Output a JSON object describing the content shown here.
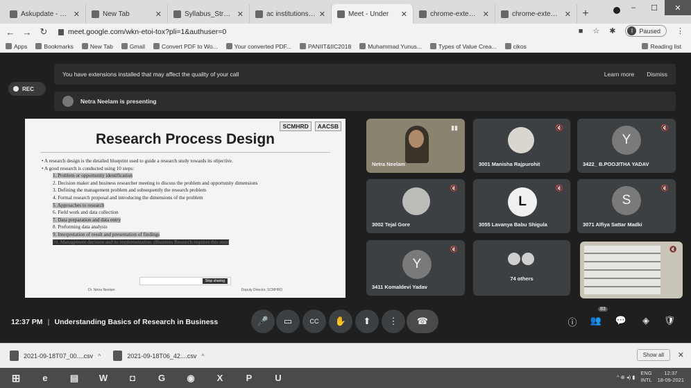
{
  "browser": {
    "tabs": [
      {
        "title": "Askupdate - What's",
        "close": "✕"
      },
      {
        "title": "New Tab",
        "close": "✕"
      },
      {
        "title": "Syllabus_Strategic",
        "close": "✕"
      },
      {
        "title": "ac institutions sele",
        "close": "✕"
      },
      {
        "title": "Meet - Under",
        "close": "✕"
      },
      {
        "title": "chrome-extension",
        "close": "✕"
      },
      {
        "title": "chrome-extension",
        "close": "✕"
      }
    ],
    "new_tab": "+",
    "window_controls": {
      "minimize": "–",
      "maximize": "☐",
      "close": "✕"
    },
    "url": "meet.google.com/wkn-etoi-tox?pli=1&authuser=0",
    "profile": {
      "initial": "I",
      "status": "Paused"
    },
    "bookmarks": [
      {
        "label": "Apps"
      },
      {
        "label": "Bookmarks"
      },
      {
        "label": "New Tab"
      },
      {
        "label": "Gmail"
      },
      {
        "label": "Convert PDF to Wo..."
      },
      {
        "label": "Your converted PDF..."
      },
      {
        "label": "PANIIT&IIC2018"
      },
      {
        "label": "Muhammad Yunus..."
      },
      {
        "label": "Types of Value Crea..."
      },
      {
        "label": "cikos"
      }
    ],
    "reading_list": "Reading list"
  },
  "meet": {
    "banner": {
      "message": "You have extensions installed that may affect the quality of your call",
      "learn_more": "Learn more",
      "dismiss": "Dismiss"
    },
    "rec_label": "REC",
    "presenting_text": "Netra Neelam is presenting",
    "slide": {
      "logos": [
        "SCMHRD",
        "AACSB"
      ],
      "title": "Research Process Design",
      "bullets": [
        "A research design is the detailed blueprint used to guide a research study towards its objective.",
        "A good research is conducted using 10 steps:"
      ],
      "steps": [
        "1. Problem or opportunity identification",
        "2. Decision maker and business researcher meeting to discuss the problem and opportunity dimensions",
        "3. Defining the management problem and subsequently the research problem",
        "4. Formal research proposal and introducing the dimensions of the problem",
        "5. Approaches to research",
        "6. Field work and data collection",
        "7. Data preparation and data entry",
        "8. Preforming data analysis",
        "9. Interpretation of result and presentation of findings",
        "10. Management decision and its implementation. (Business Research requires this step)"
      ],
      "stop_sharing": "Stop sharing",
      "footer_left": "Dr. Netra Neelam",
      "footer_right": "Deputy Director, SCMHRD"
    },
    "participants": [
      {
        "name": "Netra Neelam",
        "letter": ""
      },
      {
        "name": "3001 Manisha Rajpurohit",
        "letter": ""
      },
      {
        "name": "3422_ B.POOJITHA YADAV",
        "letter": "Y"
      },
      {
        "name": "3002 Tejal Gore",
        "letter": ""
      },
      {
        "name": "3055 Lavanya Babu Shigula",
        "letter": "L"
      },
      {
        "name": "3071 Alfiya Sattar Madki",
        "letter": "S"
      },
      {
        "name": "3411 Komaldevi Yadav",
        "letter": "Y"
      },
      {
        "name": "74 others",
        "letter": ""
      },
      {
        "name": "",
        "letter": ""
      }
    ],
    "mic_icon": "🔇",
    "controls": {
      "time": "12:37 PM",
      "separator": "|",
      "meeting_title": "Understanding Basics of Research in Business",
      "mic": "🎤",
      "camera": "▭",
      "captions": "CC",
      "hand": "✋",
      "present": "⬆",
      "more": "⋮",
      "leave": "☎",
      "info": "ⓘ",
      "people": "👥",
      "people_count": "83",
      "chat": "💬",
      "activities": "◈",
      "safety": "🛡"
    }
  },
  "downloads": {
    "items": [
      {
        "name": "2021-09-18T07_00....csv",
        "caret": "^"
      },
      {
        "name": "2021-09-18T06_42....csv",
        "caret": "^"
      }
    ],
    "show_all": "Show all",
    "close": "✕"
  },
  "taskbar": {
    "apps": [
      "⊞",
      "e",
      "▤",
      "W",
      "◘",
      "G",
      "◉",
      "X",
      "P",
      "U"
    ],
    "tray": {
      "icons": "^ ⊕ ◂) ▮",
      "lang_top": "ENG",
      "lang_bottom": "INTL",
      "time": "12:37",
      "date": "18-09-2021"
    }
  }
}
